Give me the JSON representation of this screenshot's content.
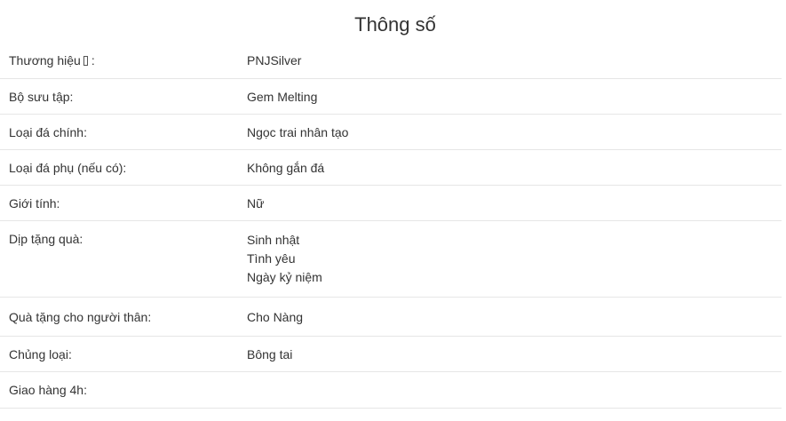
{
  "title": "Thông số",
  "rows": [
    {
      "label": "Thương hiệu",
      "label_suffix": ":",
      "values": [
        "PNJSilver"
      ]
    },
    {
      "label": "Bộ sưu tập:",
      "values": [
        "Gem Melting"
      ]
    },
    {
      "label": "Loại đá chính:",
      "values": [
        "Ngọc trai nhân tạo"
      ]
    },
    {
      "label": "Loại đá phụ (nếu có):",
      "values": [
        "Không gắn đá"
      ]
    },
    {
      "label": "Giới tính:",
      "values": [
        "Nữ"
      ]
    },
    {
      "label": "Dịp tặng quà:",
      "values": [
        "Sinh nhật",
        "Tình yêu",
        "Ngày kỷ niệm"
      ]
    },
    {
      "label": "Quà tặng cho người thân:",
      "values": [
        "Cho Nàng"
      ]
    },
    {
      "label": "Chủng loại:",
      "values": [
        "Bông tai"
      ]
    },
    {
      "label": "Giao hàng 4h:",
      "values": []
    }
  ],
  "icons": {
    "brand_info": "info-icon"
  },
  "colors": {
    "text": "#333333",
    "divider": "#e6e6e6",
    "background": "#ffffff"
  }
}
